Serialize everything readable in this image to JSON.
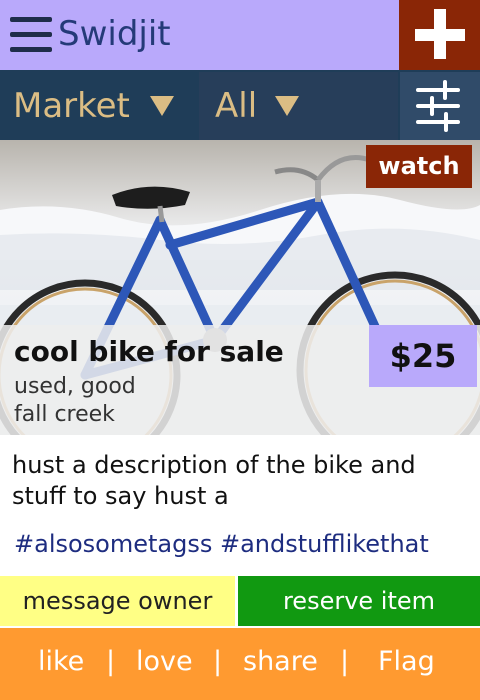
{
  "header": {
    "menu_icon": "hamburger-menu-icon",
    "app_title": "Swidjit",
    "add_icon": "plus-icon",
    "accent_color": "#b9a9fb",
    "add_button_color": "#8a2606"
  },
  "filters": {
    "category": "Market",
    "scope": "All",
    "filter_icon": "sliders-icon",
    "bar_color": "#1f3d58",
    "text_color": "#dbbd84"
  },
  "listing": {
    "watch_label": "watch",
    "title": "cool bike for sale",
    "condition": "used, good",
    "location": "fall creek",
    "price": "$25",
    "description": "hust a description of the bike and stuff to say hust a",
    "tags": "#alsosometagss #andstufflikethat",
    "photo": "blue-bicycle-in-snow-photo"
  },
  "buttons": {
    "message": "message owner",
    "reserve": "reserve item",
    "message_color": "#ffff85",
    "reserve_color": "#119911"
  },
  "actions": {
    "like": "like",
    "love": "love",
    "share": "share",
    "flag": "Flag",
    "separator": "|",
    "bar_color": "#ff9a30"
  }
}
